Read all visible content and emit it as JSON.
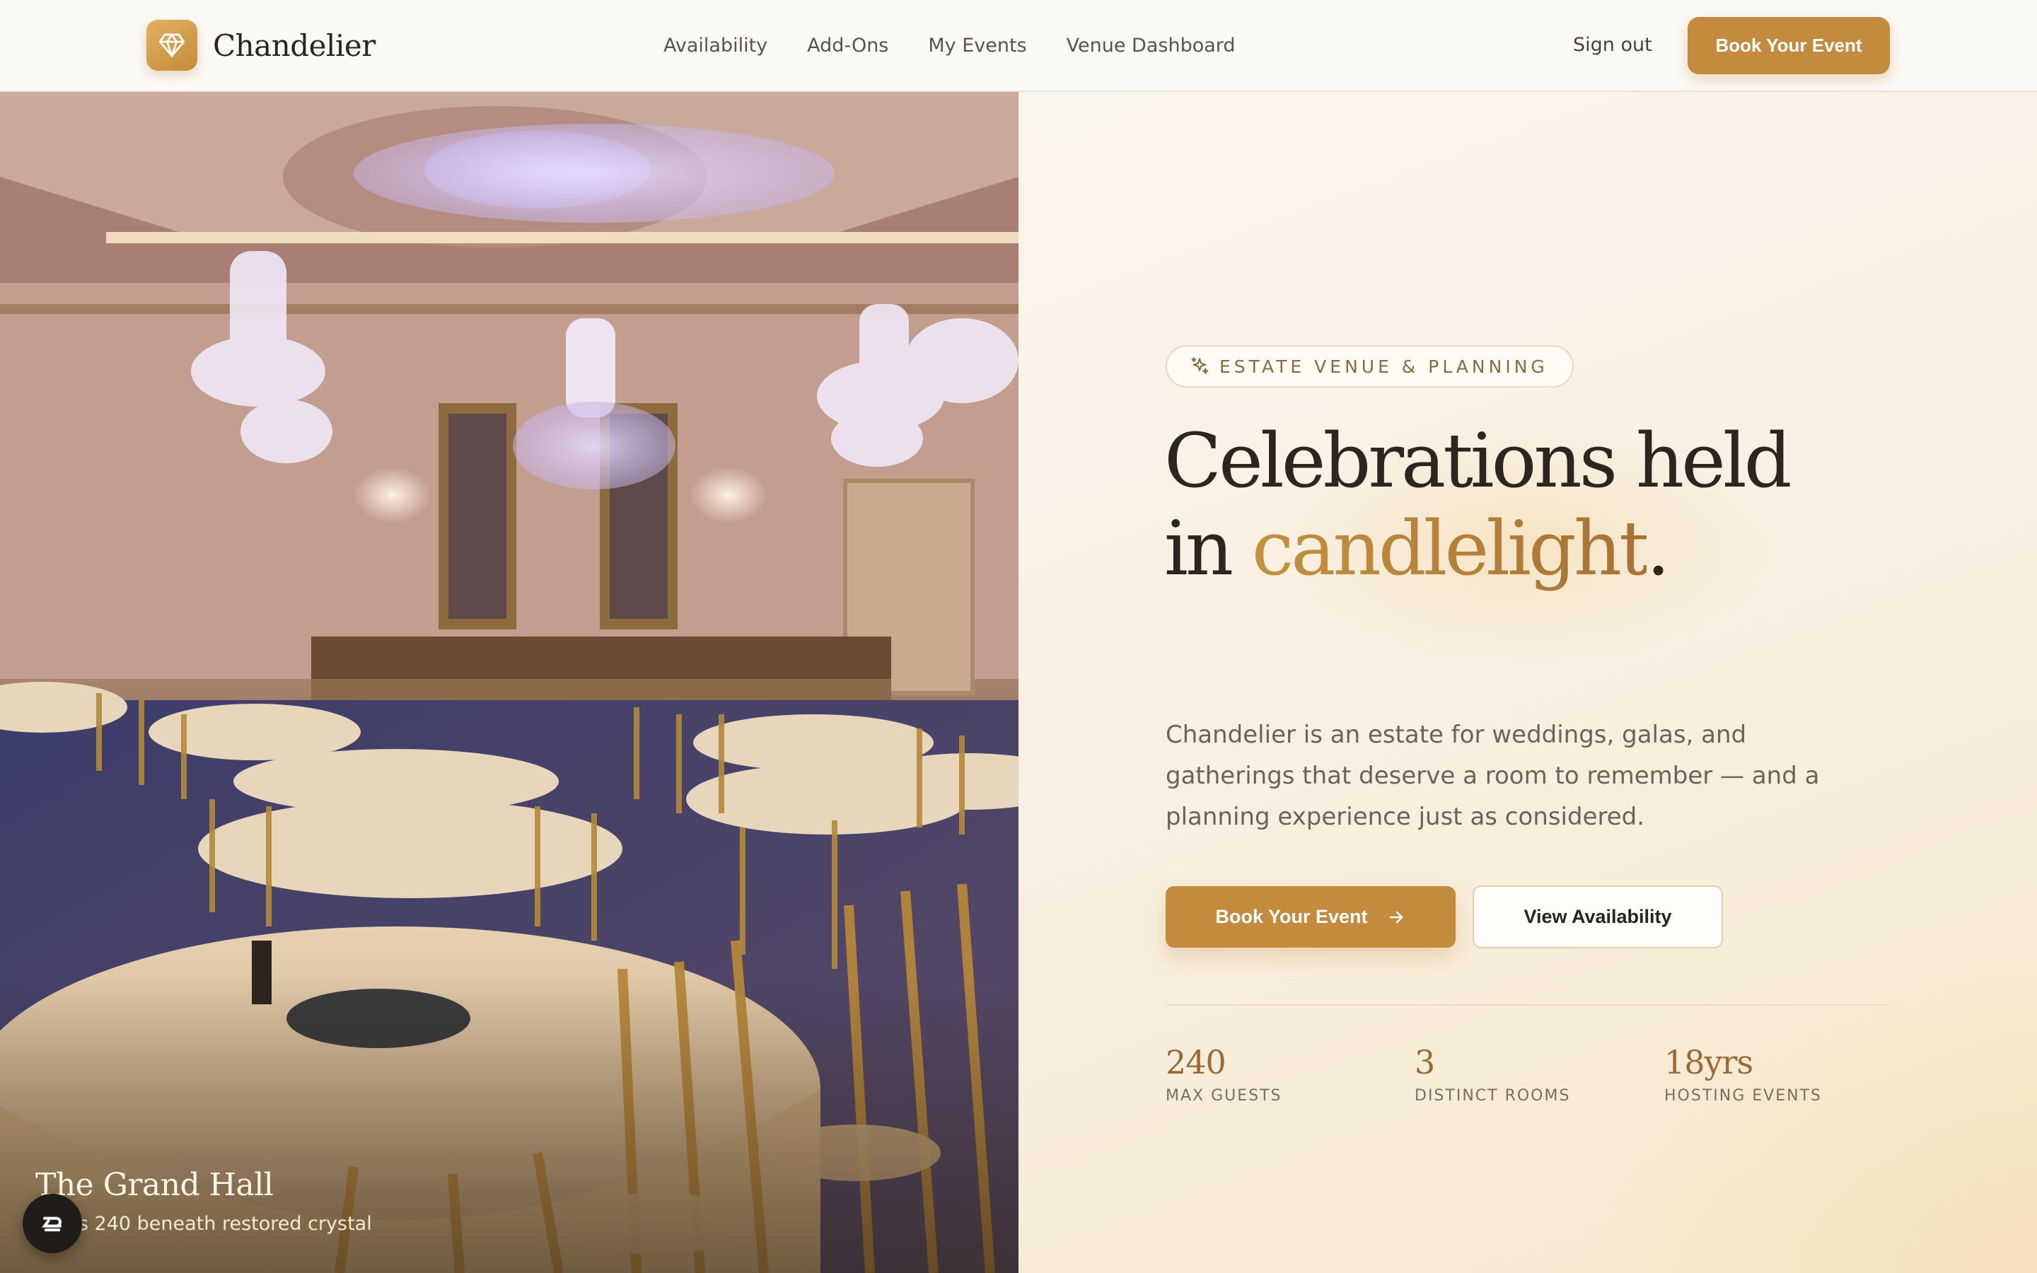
{
  "brand": {
    "name": "Chandelier",
    "icon": "diamond-icon"
  },
  "nav": {
    "links": [
      "Availability",
      "Add-Ons",
      "My Events",
      "Venue Dashboard"
    ],
    "signout": "Sign out",
    "cta": "Book Your Event"
  },
  "photo": {
    "title": "The Grand Hall",
    "subtitle": "Seats 240 beneath restored crystal"
  },
  "hero": {
    "eyebrow": "ESTATE VENUE & PLANNING",
    "eyebrow_icon": "sparkle-icon",
    "headline_line1": "Celebrations held",
    "headline_line2_prefix": "in ",
    "headline_accent": "candlelight",
    "headline_suffix": ".",
    "lede": "Chandelier is an estate for weddings, galas, and gatherings that deserve a room to remember — and a planning experience just as considered.",
    "primary_cta": "Book Your Event",
    "primary_cta_icon": "arrow-right-icon",
    "secondary_cta": "View Availability"
  },
  "stats": [
    {
      "value": "240",
      "label": "MAX GUESTS"
    },
    {
      "value": "3",
      "label": "DISTINCT ROOMS"
    },
    {
      "value": "18yrs",
      "label": "HOSTING EVENTS"
    }
  ],
  "colors": {
    "accent": "#c48a3e",
    "accent_dark": "#9b6a33",
    "text": "#2b241d",
    "muted": "#6d6258",
    "background": "#fbf8f3"
  }
}
